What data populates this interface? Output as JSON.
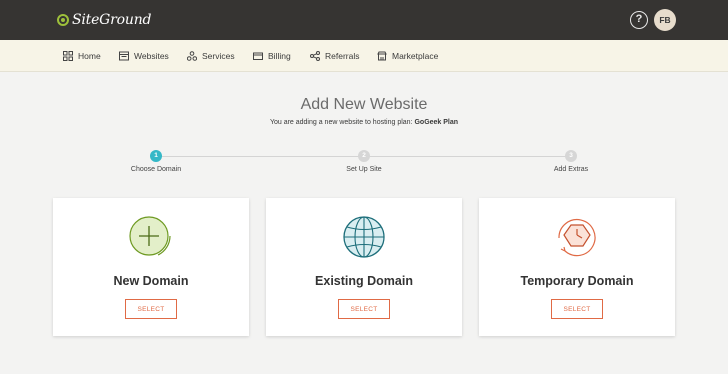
{
  "header": {
    "brand": "SiteGround",
    "help_symbol": "?",
    "avatar_initials": "FB"
  },
  "nav": {
    "items": [
      {
        "label": "Home",
        "icon": "grid-icon"
      },
      {
        "label": "Websites",
        "icon": "browser-icon"
      },
      {
        "label": "Services",
        "icon": "cluster-icon"
      },
      {
        "label": "Billing",
        "icon": "card-icon"
      },
      {
        "label": "Referrals",
        "icon": "share-icon"
      },
      {
        "label": "Marketplace",
        "icon": "store-icon"
      }
    ]
  },
  "page": {
    "title": "Add New Website",
    "subtitle_prefix": "You are adding a new website to hosting plan:",
    "plan_name": "GoGeek Plan"
  },
  "steps": [
    {
      "number": "1",
      "label": "Choose Domain",
      "active": true
    },
    {
      "number": "2",
      "label": "Set Up Site",
      "active": false
    },
    {
      "number": "3",
      "label": "Add Extras",
      "active": false
    }
  ],
  "cards": [
    {
      "title": "New Domain",
      "button": "SELECT",
      "icon": "plus-circle-icon",
      "color": "#7aa02f"
    },
    {
      "title": "Existing Domain",
      "button": "SELECT",
      "icon": "globe-icon",
      "color": "#1d7f8c"
    },
    {
      "title": "Temporary Domain",
      "button": "SELECT",
      "icon": "clock-icon",
      "color": "#e06a45"
    }
  ],
  "colors": {
    "topbar": "#363432",
    "navbar": "#f7f4e7",
    "accent": "#e06a45",
    "step_active": "#35b8c7",
    "brand_green": "#9ec03b"
  }
}
